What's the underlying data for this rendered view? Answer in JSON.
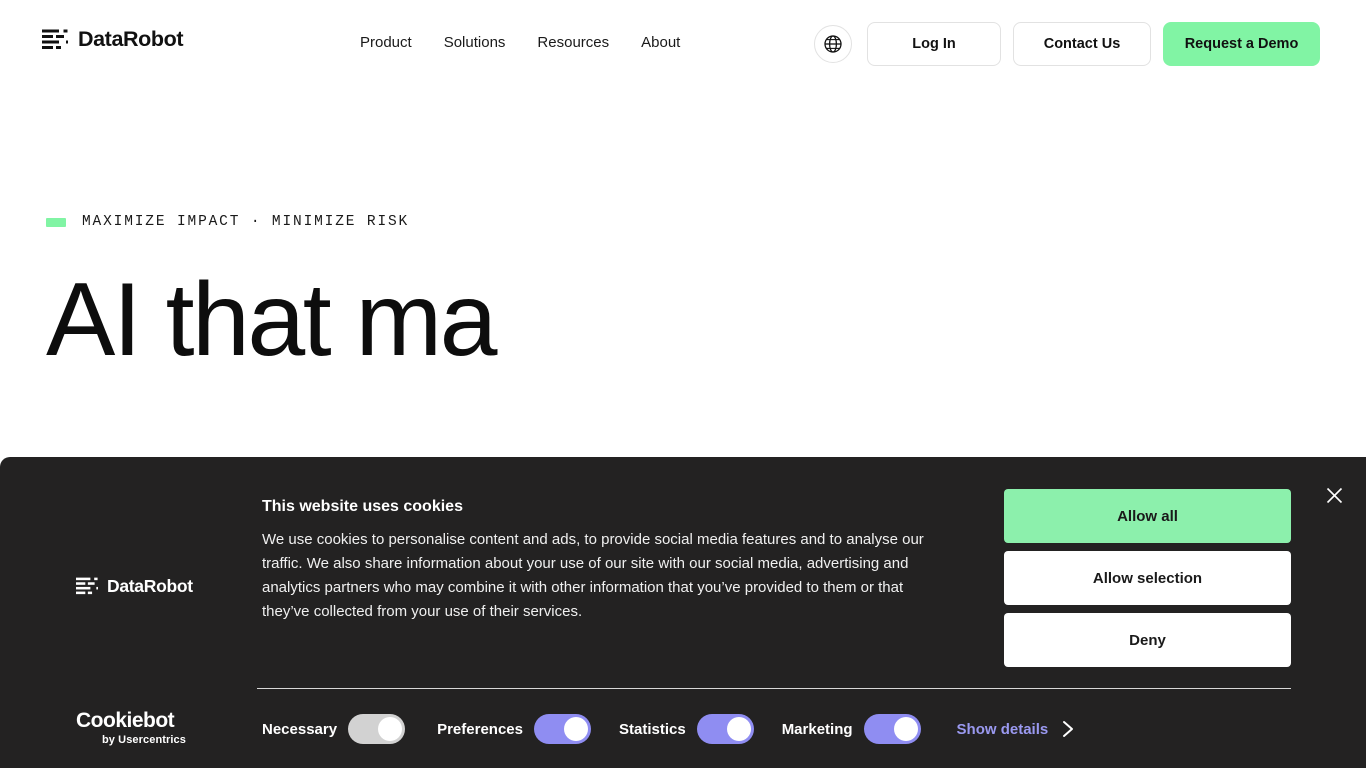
{
  "header": {
    "brand": {
      "name": "DataRobot",
      "mark_icon": "datarobot-bars-icon"
    },
    "nav": [
      {
        "label": "Product"
      },
      {
        "label": "Solutions"
      },
      {
        "label": "Resources"
      },
      {
        "label": "About"
      }
    ],
    "actions": {
      "globe_icon": "globe-icon",
      "login_label": "Log In",
      "contact_label": "Contact Us",
      "demo_label": "Request a Demo",
      "demo_color": "#81F4A4"
    }
  },
  "hero": {
    "eyebrow": "MAXIMIZE IMPACT · MINIMIZE RISK",
    "eyebrow_accent_color": "#81F4A4",
    "title": "AI that ma"
  },
  "cookie_banner": {
    "close_icon": "close-icon",
    "brand": {
      "name": "DataRobot",
      "mark_icon": "datarobot-bars-icon"
    },
    "heading": "This website uses cookies",
    "body": "We use cookies to personalise content and ads, to provide social media features and to analyse our traffic. We also share information about your use of our site with our social media, advertising and analytics partners who may combine it with other information that you’ve provided to them or that they’ve collected from your use of their services.",
    "buttons": {
      "allow_all": "Allow all",
      "allow_selection": "Allow selection",
      "deny": "Deny"
    },
    "consent_categories": [
      {
        "label": "Necessary",
        "state": "on",
        "locked": true
      },
      {
        "label": "Preferences",
        "state": "on",
        "locked": false
      },
      {
        "label": "Statistics",
        "state": "on",
        "locked": false
      },
      {
        "label": "Marketing",
        "state": "on",
        "locked": false
      }
    ],
    "show_details": {
      "label": "Show details",
      "chevron_icon": "chevron-right-icon",
      "color": "#9a99f0"
    },
    "provider": {
      "name": "Cookiebot",
      "tagline": "by Usercentrics"
    },
    "background_color": "#232222",
    "toggle_on_color": "#8f8df2",
    "toggle_locked_color": "#d2d2d2"
  }
}
